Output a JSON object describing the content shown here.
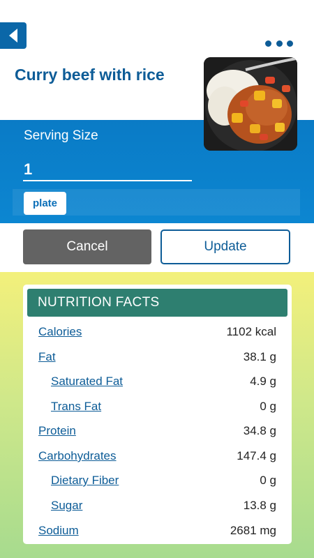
{
  "header": {
    "back_icon": "chevron-left-icon",
    "more_icon": "more-horizontal-icon",
    "title": "Curry beef with rice"
  },
  "serving": {
    "label": "Serving Size",
    "quantity": "1",
    "unit": "plate"
  },
  "actions": {
    "cancel_label": "Cancel",
    "update_label": "Update"
  },
  "nutrition": {
    "title": "NUTRITION FACTS",
    "rows": [
      {
        "label": "Calories",
        "value": "1102 kcal",
        "sub": false
      },
      {
        "label": "Fat",
        "value": "38.1 g",
        "sub": false
      },
      {
        "label": "Saturated Fat",
        "value": "4.9 g",
        "sub": true
      },
      {
        "label": "Trans Fat",
        "value": "0 g",
        "sub": true
      },
      {
        "label": "Protein",
        "value": "34.8 g",
        "sub": false
      },
      {
        "label": "Carbohydrates",
        "value": "147.4 g",
        "sub": false
      },
      {
        "label": "Dietary Fiber",
        "value": "0 g",
        "sub": true
      },
      {
        "label": "Sugar",
        "value": "13.8 g",
        "sub": true
      },
      {
        "label": "Sodium",
        "value": "2681 mg",
        "sub": false
      }
    ]
  },
  "colors": {
    "brand_blue": "#0d5c97",
    "serving_band": "#0a7bc6",
    "cancel_gray": "#636363",
    "nutrition_header": "#2e7f70"
  }
}
